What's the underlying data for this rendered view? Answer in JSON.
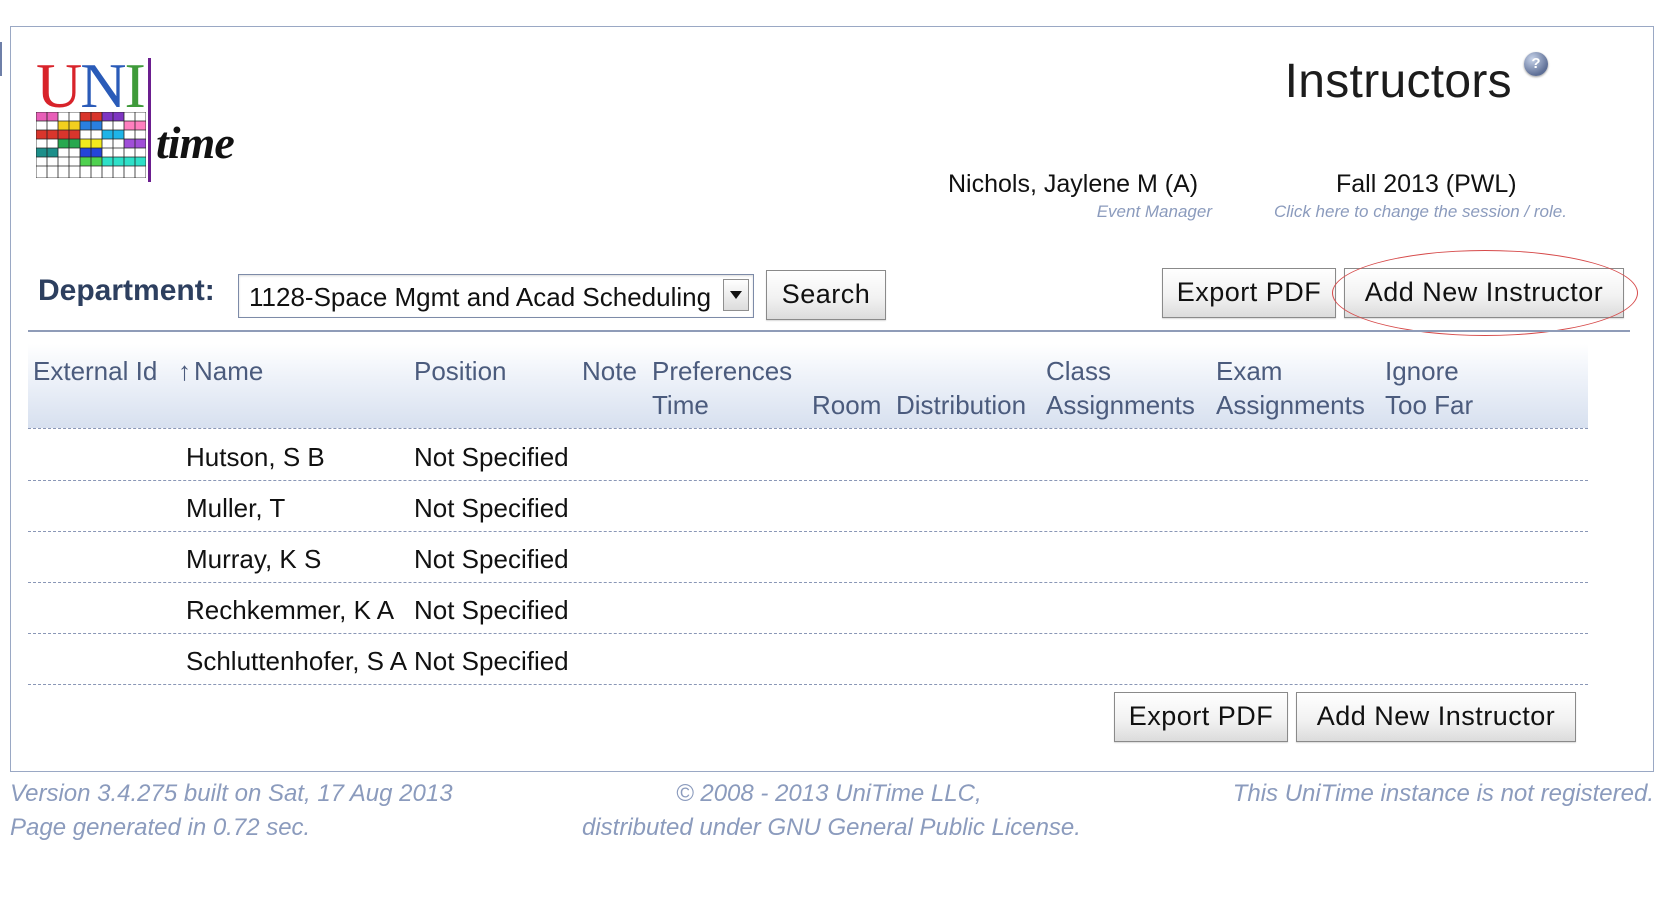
{
  "logo": {
    "u": "U",
    "n": "N",
    "i": "I",
    "time": "time"
  },
  "header": {
    "title": "Instructors",
    "help_icon": "?",
    "user_name": "Nichols, Jaylene M (A)",
    "user_role": "Event Manager",
    "session_name": "Fall 2013 (PWL)",
    "session_hint": "Click here to change the session / role."
  },
  "filter": {
    "department_label": "Department:",
    "department_value": "1128-Space Mgmt and Acad Scheduling",
    "search_label": "Search"
  },
  "actions": {
    "export_pdf": "Export PDF",
    "add_new_instructor": "Add New Instructor"
  },
  "table": {
    "headers": {
      "external_id": "External Id",
      "name_sort": "↑",
      "name": "Name",
      "position": "Position",
      "note": "Note",
      "preferences": "Preferences",
      "time": "Time",
      "room": "Room",
      "distribution": "Distribution",
      "class_1": "Class",
      "class_2": "Assignments",
      "exam_1": "Exam",
      "exam_2": "Assignments",
      "ignore_1": "Ignore",
      "ignore_2": "Too Far"
    },
    "rows": [
      {
        "name": "Hutson, S B",
        "position": "Not Specified"
      },
      {
        "name": "Muller, T",
        "position": "Not Specified"
      },
      {
        "name": "Murray, K S",
        "position": "Not Specified"
      },
      {
        "name": "Rechkemmer, K A",
        "position": "Not Specified"
      },
      {
        "name": "Schluttenhofer, S A",
        "position": "Not Specified"
      }
    ]
  },
  "footer": {
    "version": "Version 3.4.275 built on Sat, 17 Aug 2013",
    "generated": "Page generated in 0.72 sec.",
    "copyright": "© 2008 - 2013 UniTime LLC,",
    "license": "distributed under GNU General Public License.",
    "registration": "This UniTime instance is not registered."
  },
  "colors": {
    "accent_border": "#9aa8c4",
    "header_text": "#4b5b7d",
    "muted_italic": "#8b9bbd",
    "highlight": "#d64a4a"
  }
}
